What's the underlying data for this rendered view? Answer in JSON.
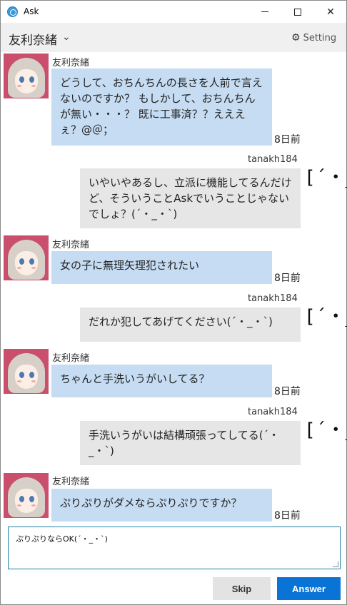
{
  "window": {
    "title": "Ask"
  },
  "header": {
    "name": "友利奈緒",
    "settings_label": "Setting"
  },
  "messages": [
    {
      "side": "left",
      "sender": "友利奈緒",
      "text": "どうして、おちんちんの長さを人前で言えないのですか？ もしかして、おちんちんが無い・・・？ 既に工事済？？えええぇ？@＠；",
      "time": "8日前"
    },
    {
      "side": "right",
      "sender": "tanakh184",
      "text": "いやいやあるし、立派に機能してるんだけど、そういうことAskでいうことじゃないでしょ？(´・_・`)",
      "face": "[´・_"
    },
    {
      "side": "left",
      "sender": "友利奈緒",
      "text": "女の子に無理矢理犯されたい",
      "time": "8日前"
    },
    {
      "side": "right",
      "sender": "tanakh184",
      "text": "だれか犯してあげてください(´・_・`)",
      "face": "[´・_"
    },
    {
      "side": "left",
      "sender": "友利奈緒",
      "text": "ちゃんと手洗いうがいしてる？",
      "time": "8日前"
    },
    {
      "side": "right",
      "sender": "tanakh184",
      "text": "手洗いうがいは結構頑張ってしてる(´・_・`)",
      "face": "[´・_"
    },
    {
      "side": "left",
      "sender": "友利奈緒",
      "text": "ぷりぷりがダメならぷりぷりですか？",
      "time": "8日前"
    }
  ],
  "answer": {
    "value": "ぷりぷりならOK(´・_・`)"
  },
  "buttons": {
    "skip": "Skip",
    "answer": "Answer"
  }
}
